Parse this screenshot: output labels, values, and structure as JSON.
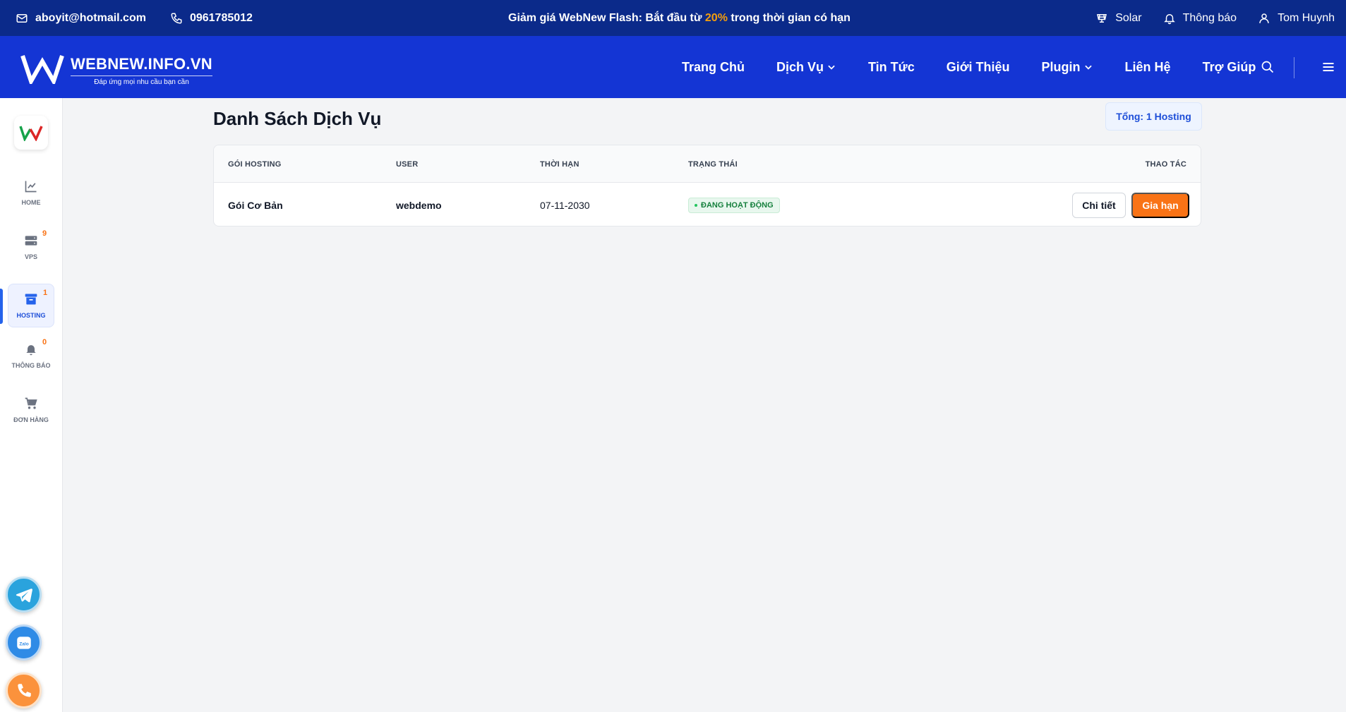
{
  "topbar": {
    "email": "aboyit@hotmail.com",
    "phone": "0961785012",
    "promo_prefix": "Giảm giá WebNew Flash: Bắt đầu từ ",
    "promo_highlight": "20%",
    "promo_suffix": " trong thời gian có hạn",
    "solar_label": "Solar",
    "notifications_label": "Thông báo",
    "user_name": "Tom Huynh"
  },
  "header": {
    "logo_title": "WEBNEW.INFO.VN",
    "logo_subtitle": "Đáp ứng mọi nhu cầu bạn cần",
    "nav": [
      {
        "label": "Trang Chủ"
      },
      {
        "label": "Dịch Vụ"
      },
      {
        "label": "Tin Tức"
      },
      {
        "label": "Giới Thiệu"
      },
      {
        "label": "Plugin"
      },
      {
        "label": "Liên Hệ"
      },
      {
        "label": "Trợ Giúp"
      }
    ]
  },
  "sidebar": {
    "items": [
      {
        "label": "HOME",
        "badge": ""
      },
      {
        "label": "VPS",
        "badge": "9"
      },
      {
        "label": "HOSTING",
        "badge": "1"
      },
      {
        "label": "THÔNG BÁO",
        "badge": "0"
      },
      {
        "label": "ĐƠN HÀNG",
        "badge": ""
      }
    ],
    "active_item": "HOSTING"
  },
  "main": {
    "title": "Danh Sách Dịch Vụ",
    "total_label": "Tổng: 1 Hosting",
    "table": {
      "columns": [
        "GÓI HOSTING",
        "USER",
        "THỜI HẠN",
        "TRẠNG THÁI",
        "THAO TÁC"
      ],
      "rows": [
        {
          "package": "Gói Cơ Bản",
          "user": "webdemo",
          "expiry": "07-11-2030",
          "status": "ĐANG HOẠT ĐỘNG",
          "detail_label": "Chi tiết",
          "renew_label": "Gia hạn"
        }
      ]
    }
  },
  "colors": {
    "topbar_bg": "#0b2a8a",
    "header_bg": "#1435d4",
    "accent_orange": "#f97316",
    "status_green": "#15803d"
  },
  "icons": [
    "mail-icon",
    "phone-icon",
    "solar-icon",
    "bell-icon",
    "user-icon",
    "search-icon",
    "menu-icon",
    "chart-icon",
    "server-icon",
    "archive-icon",
    "cart-icon",
    "telegram-icon",
    "zalo-icon",
    "call-icon"
  ]
}
